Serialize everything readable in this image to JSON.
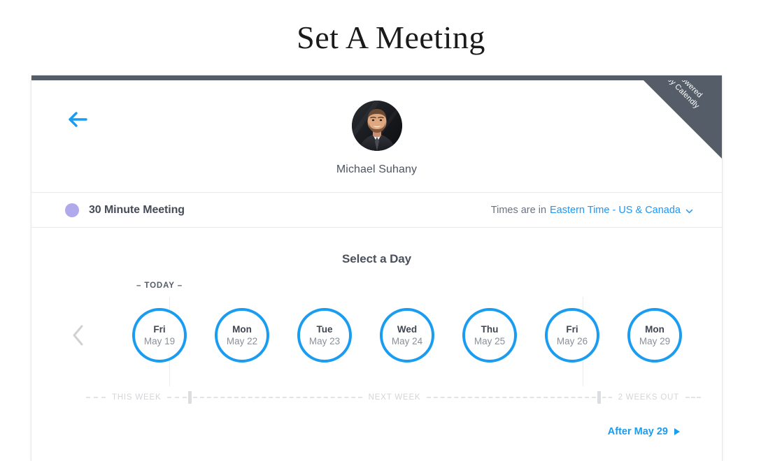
{
  "page": {
    "title": "Set A Meeting"
  },
  "ribbon": {
    "line1": "powered",
    "line2": "by Calendly"
  },
  "header": {
    "back_icon": "arrow-left-icon",
    "avatar_alt": "host-avatar",
    "host_name": "Michael Suhany"
  },
  "meta": {
    "event_dot_color": "#b0aaec",
    "event_name": "30 Minute Meeting",
    "timezone_prefix": "Times are in",
    "timezone_value": "Eastern Time - US & Canada",
    "timezone_chevron": "chevron-down-icon"
  },
  "calendar": {
    "section_title": "Select a Day",
    "today_label": "– TODAY –",
    "prev_icon": "chevron-left-icon",
    "next_icon": "chevron-right-icon",
    "prev_enabled": false,
    "next_enabled": true,
    "accent_color": "#1a9cf0",
    "days": [
      {
        "dow": "Fri",
        "date": "May 19"
      },
      {
        "dow": "Mon",
        "date": "May 22"
      },
      {
        "dow": "Tue",
        "date": "May 23"
      },
      {
        "dow": "Wed",
        "date": "May 24"
      },
      {
        "dow": "Thu",
        "date": "May 25"
      },
      {
        "dow": "Fri",
        "date": "May 26"
      },
      {
        "dow": "Mon",
        "date": "May 29"
      }
    ],
    "timeline": {
      "this_week": "THIS WEEK",
      "next_week": "NEXT WEEK",
      "two_weeks_out": "2 WEEKS OUT"
    },
    "after_label": "After May 29",
    "after_icon": "triangle-right-icon"
  }
}
